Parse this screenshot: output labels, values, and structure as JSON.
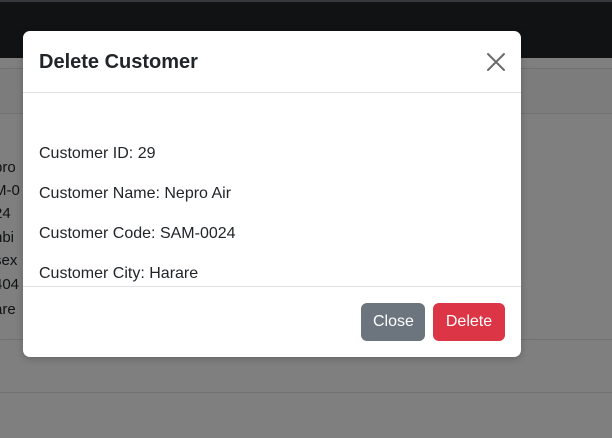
{
  "background": {
    "fragments": [
      "pro",
      "M-0",
      "24",
      "nbi",
      "sex",
      "404",
      "are"
    ]
  },
  "modal": {
    "title": "Delete Customer",
    "lines": {
      "id": "Customer ID: 29",
      "name": "Customer Name: Nepro Air",
      "code": "Customer Code: SAM-0024",
      "city": "Customer City: Harare"
    },
    "buttons": {
      "close": "Close",
      "delete": "Delete"
    }
  },
  "colors": {
    "topbar": "#212529",
    "secondary": "#6c757d",
    "danger": "#dc3545"
  },
  "icons": {
    "close": "close-icon"
  }
}
